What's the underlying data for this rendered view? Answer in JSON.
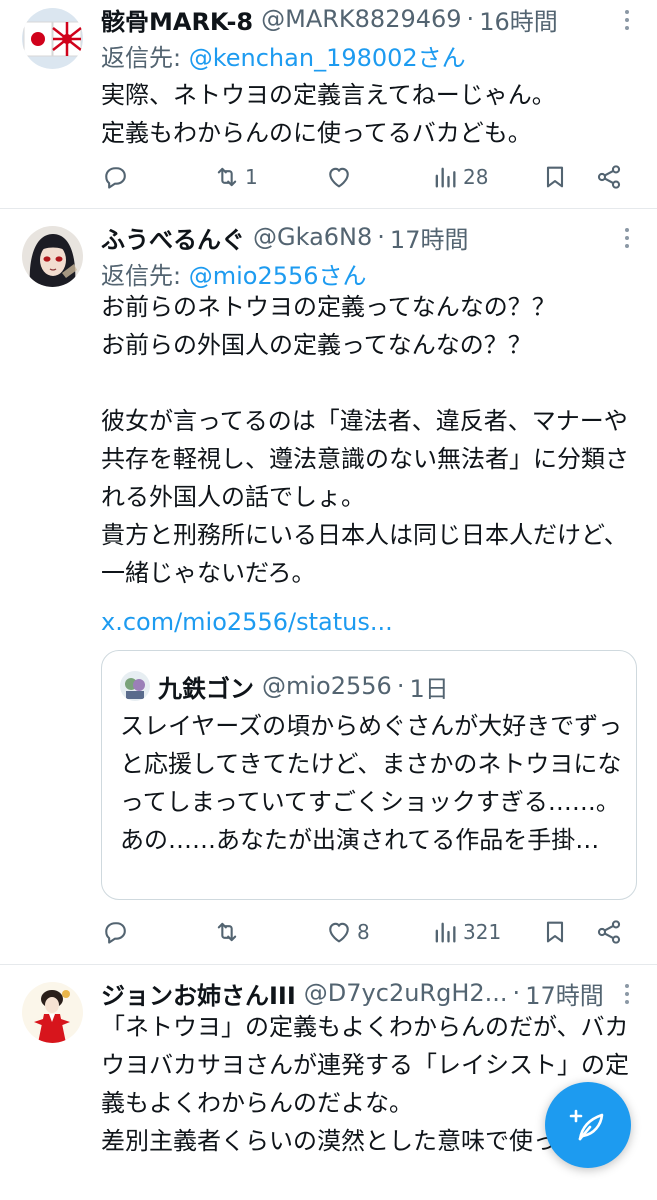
{
  "tweets": [
    {
      "name": "骸骨MARK-8",
      "handle": "@MARK8829469",
      "sep": "·",
      "time": "16時間",
      "reply_prefix": "返信先: ",
      "reply_to": "@kenchan_198002さん",
      "text": "実際、ネトウヨの定義言えてねーじゃん。\n定義もわからんのに使ってるバカども。",
      "retweets": "1",
      "likes": "",
      "views": "28",
      "avatar_icon": "flag-avatar"
    },
    {
      "name": "ふうべるんぐ",
      "handle": "@Gka6N8",
      "sep": "·",
      "time": "17時間",
      "reply_prefix": "返信先: ",
      "reply_to": "@mio2556さん",
      "text": "お前らのネトウヨの定義ってなんなの？？\nお前らの外国人の定義ってなんなの？？\n\n彼女が言ってるのは「違法者、違反者、マナーや共存を軽視し、遵法意識のない無法者」に分類される外国人の話でしょ。\n貴方と刑務所にいる日本人は同じ日本人だけど、一緒じゃないだろ。",
      "link": "x.com/mio2556/status...",
      "quote": {
        "name": "九鉄ゴン",
        "handle": "@mio2556",
        "sep": "·",
        "time": "1日",
        "text": "スレイヤーズの頃からめぐさんが大好きでずっと応援してきてたけど、まさかのネトウヨになってしまっていてすごくショックすぎる……。\nあの……あなたが出演されてる作品を手掛…"
      },
      "retweets": "",
      "likes": "8",
      "views": "321",
      "avatar_icon": "anime-avatar"
    },
    {
      "name": "ジョンお姉さんIII",
      "handle": "@D7yc2uRgH2...",
      "sep": "·",
      "time": "17時間",
      "text": "「ネトウヨ」の定義もよくわからんのだが、バカウヨバカサヨさんが連発する「レイシスト」の定義もよくわからんのだよな。\n差別主義者くらいの漠然とした意味で使ってる？",
      "avatar_icon": "kimono-avatar"
    }
  ],
  "colors": {
    "accent": "#1d9bf0",
    "text": "#0f1419",
    "muted": "#536471",
    "border": "#cfd9de"
  },
  "compose_button": {
    "icon": "compose-feather-icon"
  }
}
